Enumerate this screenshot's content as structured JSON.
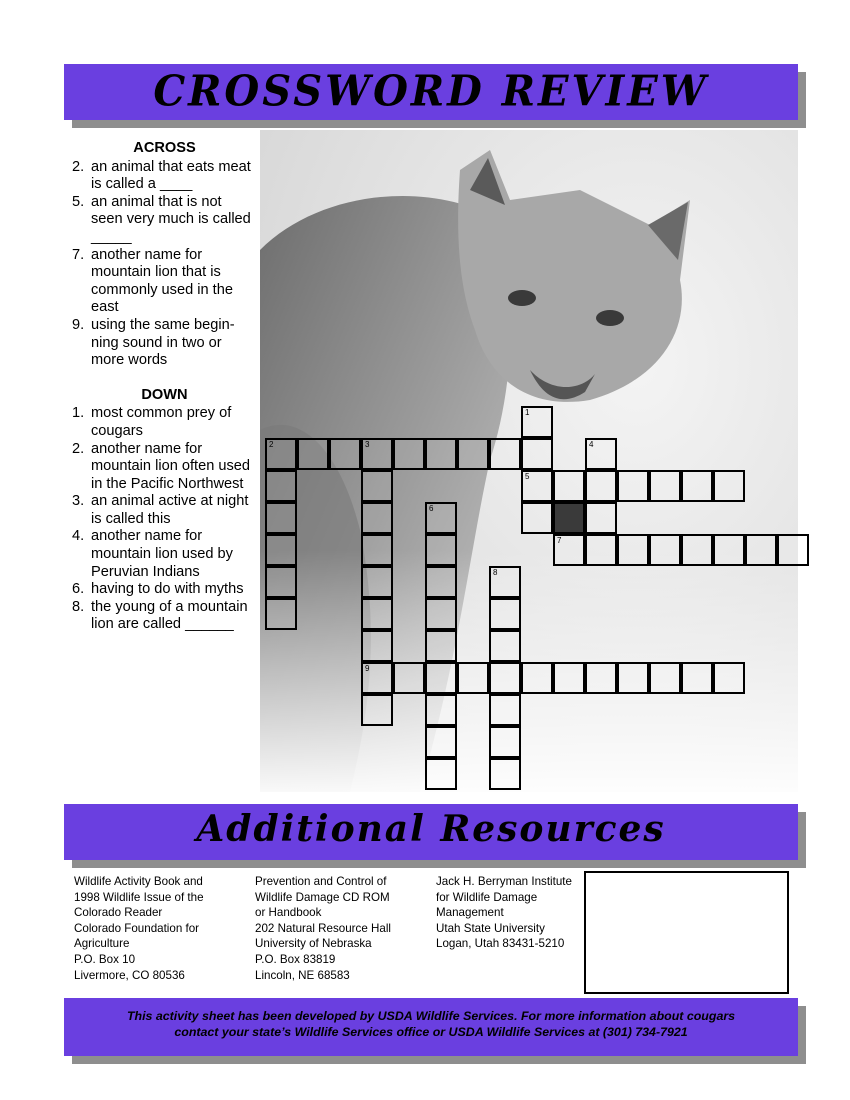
{
  "header": {
    "title": "CROSSWORD REVIEW"
  },
  "clues": {
    "across_heading": "ACROSS",
    "across": [
      {
        "num": "2.",
        "text": "an animal that eats meat is called a ____"
      },
      {
        "num": "5.",
        "text": "an animal that is not seen very much is called _____"
      },
      {
        "num": "7.",
        "text": "another name for mountain lion that is commonly used in the east"
      },
      {
        "num": "9.",
        "text": "using the same begin-ning sound in two or more words"
      }
    ],
    "down_heading": "DOWN",
    "down": [
      {
        "num": "1.",
        "text": "most common prey of cougars"
      },
      {
        "num": "2.",
        "text": "another name for mountain lion often used in the Pacific Northwest"
      },
      {
        "num": "3.",
        "text": "an animal active at night is called this"
      },
      {
        "num": "4.",
        "text": "another name for mountain lion used by Peruvian Indians"
      },
      {
        "num": "6.",
        "text": "having to do with myths"
      },
      {
        "num": "8.",
        "text": "the young of a mountain lion are called ______"
      }
    ]
  },
  "grid": {
    "numbers": [
      "1",
      "2",
      "3",
      "4",
      "5",
      "6",
      "7",
      "8",
      "9"
    ]
  },
  "resources": {
    "title": "Additional Resources",
    "columns": [
      [
        "Wildlife Activity Book and",
        "1998 Wildlife Issue of the",
        "Colorado Reader",
        "Colorado Foundation for",
        "Agriculture",
        "P.O. Box 10",
        "Livermore, CO 80536"
      ],
      [
        "Prevention and Control of",
        "Wildlife Damage CD ROM",
        "or Handbook",
        "202 Natural Resource Hall",
        "University of Nebraska",
        "P.O. Box 83819",
        "Lincoln, NE 68583"
      ],
      [
        "Jack H. Berryman Institute",
        "for Wildlife Damage",
        "Management",
        "Utah State University",
        "Logan, Utah 83431-5210"
      ]
    ]
  },
  "footer": {
    "line1": "This activity sheet has been developed by USDA Wildlife Services. For more information about cougars",
    "line2": "contact your state’s Wildlife Services office or USDA Wildlife Services at (301) 734-7921"
  },
  "colors": {
    "banner": "#6a3fe0",
    "shadow": "#8e8e8e"
  }
}
